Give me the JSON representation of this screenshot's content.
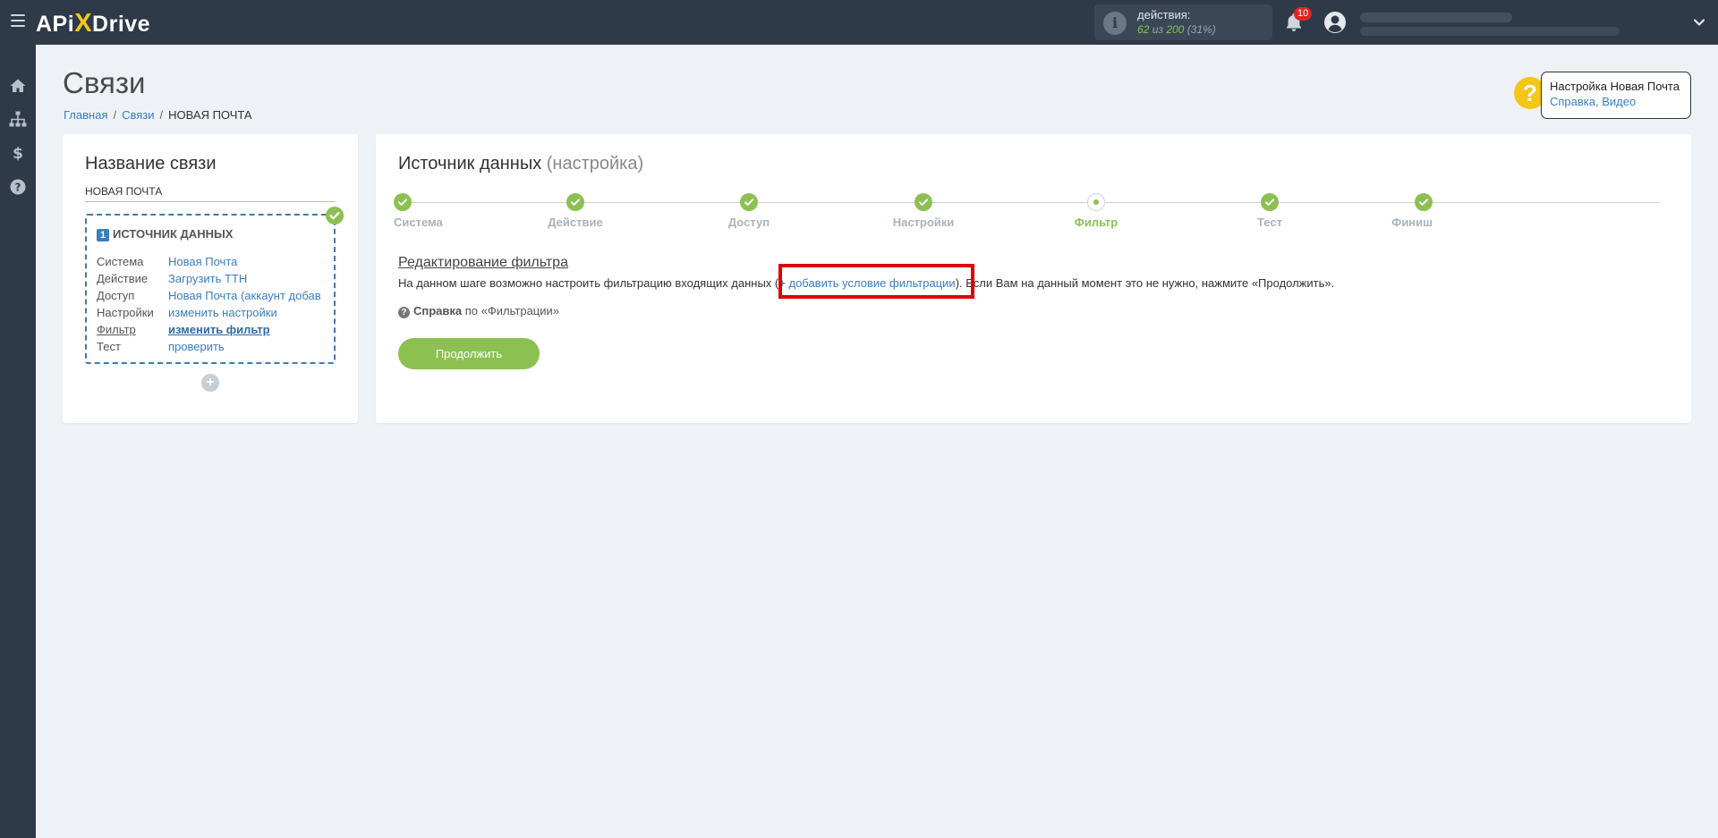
{
  "header": {
    "logo_left": "APi",
    "logo_x": "X",
    "logo_right": "Drive",
    "actions_label": "действия:",
    "actions_used": "62",
    "actions_of": "из",
    "actions_total": "200",
    "actions_percent": "(31%)",
    "notifications_count": "10"
  },
  "page": {
    "title": "Связи",
    "breadcrumb": {
      "home": "Главная",
      "links": "Связи",
      "current": "НОВАЯ ПОЧТА"
    }
  },
  "help": {
    "title": "Настройка Новая Почта",
    "links": "Справка, Видео"
  },
  "left_card": {
    "heading": "Название связи",
    "connection_name": "НОВАЯ ПОЧТА",
    "source": {
      "number": "1",
      "title": "ИСТОЧНИК ДАННЫХ",
      "rows": [
        {
          "key": "Система",
          "value": "Новая Почта"
        },
        {
          "key": "Действие",
          "value": "Загрузить ТТН"
        },
        {
          "key": "Доступ",
          "value": "Новая Почта (аккаунт добав"
        },
        {
          "key": "Настройки",
          "value": "изменить настройки"
        },
        {
          "key": "Фильтр",
          "value": "изменить фильтр"
        },
        {
          "key": "Тест",
          "value": "проверить"
        }
      ]
    },
    "add_label": "+"
  },
  "right_card": {
    "title": "Источник данных",
    "title_sub": "(настройка)",
    "steps": [
      {
        "label": "Система",
        "state": "done"
      },
      {
        "label": "Действие",
        "state": "done"
      },
      {
        "label": "Доступ",
        "state": "done"
      },
      {
        "label": "Настройки",
        "state": "done"
      },
      {
        "label": "Фильтр",
        "state": "active"
      },
      {
        "label": "Тест",
        "state": "done"
      },
      {
        "label": "Финиш",
        "state": "done"
      }
    ],
    "filter_heading": "Редактирование фильтра",
    "filter_desc_before": "На данном шаге возможно настроить фильтрацию входящих данных",
    "add_condition_plus": "+",
    "add_condition_label": "добавить условие фильтрации",
    "filter_desc_after": "Если Вам на данный момент это не нужно, нажмите «Продолжить».",
    "help_label": "Справка",
    "help_mid": "по",
    "help_topic": "«Фильтрации»",
    "continue_label": "Продолжить"
  },
  "colors": {
    "accent_green": "#8cc152",
    "link_blue": "#3b7dc0",
    "topbar": "#2e3a48",
    "highlight_red": "#e00000",
    "logo_yellow": "#f5c518"
  },
  "icons": [
    "menu-icon",
    "info-icon",
    "bell-icon",
    "user-icon",
    "chevron-down-icon",
    "home-icon",
    "sitemap-icon",
    "dollar-icon",
    "question-icon",
    "check-icon"
  ]
}
